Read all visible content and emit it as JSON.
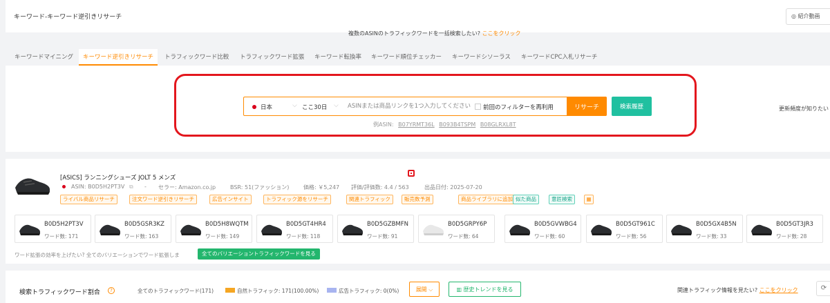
{
  "header": {
    "title": "キーワード-キーワード逆引きリサーチ",
    "referral_button": "◎ 紹介動画"
  },
  "tabs": [
    {
      "label": "キーワードマイニング"
    },
    {
      "label": "キーワード逆引きリサーチ",
      "active": true
    },
    {
      "label": "トラフィックワード比較"
    },
    {
      "label": "トラフィックワード拡張"
    },
    {
      "label": "キーワード転換率"
    },
    {
      "label": "キーワード順位チェッカー"
    },
    {
      "label": "キーワードシソーラス"
    },
    {
      "label": "キーワードCPC入札リサーチ"
    }
  ],
  "search": {
    "hint": "複数のASINのトラフィックワードを一括検索したい?",
    "hint_link": "ここをクリック",
    "country": "日本",
    "period": "ここ30日",
    "placeholder": "ASINまたは商品リンクを1つ入力してください",
    "reuse_filter": "前回のフィルターを再利用",
    "search_button": "リサーチ",
    "history_button": "検索履歴",
    "examples_label": "例ASIN:",
    "examples": [
      "B07YRMT36L",
      "B093B4TSPM",
      "B08GLRXL8T"
    ],
    "update_note": "更新頻度が知りたい"
  },
  "product": {
    "title": "[ASICS] ランニングシューズ JOLT 5 メンズ",
    "asin": "ASIN: B0D5H2PT3V",
    "separator": "-",
    "seller": "セラー: Amazon.co.jp",
    "bsr": "BSR: 51(ファッション)",
    "price": "価格: ￥5,247",
    "rating": "評価/評価数: 4.4 / 563",
    "listed": "出品日付: 2025-07-20",
    "tags": [
      "ライバル商品リサーチ",
      "注文ワード逆引きリサーチ",
      "広告インサイト",
      "トラフィック源をリサーチ",
      "関連トラフィック",
      "販売数予測",
      "商品ライブラリに追加",
      "似た商品",
      "意匠検索"
    ]
  },
  "variations": [
    {
      "asin": "B0D5H2PT3V",
      "count": "ワード数: 171",
      "color": "black"
    },
    {
      "asin": "B0D5GSR3KZ",
      "count": "ワード数: 163",
      "color": "black"
    },
    {
      "asin": "B0D5H8WQTM",
      "count": "ワード数: 149",
      "color": "black"
    },
    {
      "asin": "B0D5GT4HR4",
      "count": "ワード数: 118",
      "color": "black"
    },
    {
      "asin": "B0D5GZBMFN",
      "count": "ワード数: 91",
      "color": "black"
    },
    {
      "asin": "B0D5GRPY6P",
      "count": "ワード数: 64",
      "color": "white"
    },
    {
      "asin": "B0D5GVWBG4",
      "count": "ワード数: 60",
      "color": "black"
    },
    {
      "asin": "B0D5GT961C",
      "count": "ワード数: 56",
      "color": "black"
    },
    {
      "asin": "B0D5GX4B5N",
      "count": "ワード数: 33",
      "color": "black"
    },
    {
      "asin": "B0D5GT3JR3",
      "count": "ワード数: 28",
      "color": "black"
    }
  ],
  "expand": {
    "hint": "ワード拡張の効率を上げたい? 全てのバリエーションでワード拡張しま",
    "button": "全てのバリエーショントラフィックワードを見る"
  },
  "traffic_share": {
    "title": "検索トラフィックワード割合",
    "all": "全てのトラフィックワード(171)",
    "natural": "自然トラフィック: 171(100.00%)",
    "ads": "広告トラフィック: 0(0%)",
    "natural_color": "#f5a623",
    "ads_color": "#a8b4f0",
    "expand_button": "展開",
    "trend_button": "歴史トレンドを見る",
    "related": "関連トラフィック情報を見たい?",
    "related_link": "ここをクリック"
  }
}
